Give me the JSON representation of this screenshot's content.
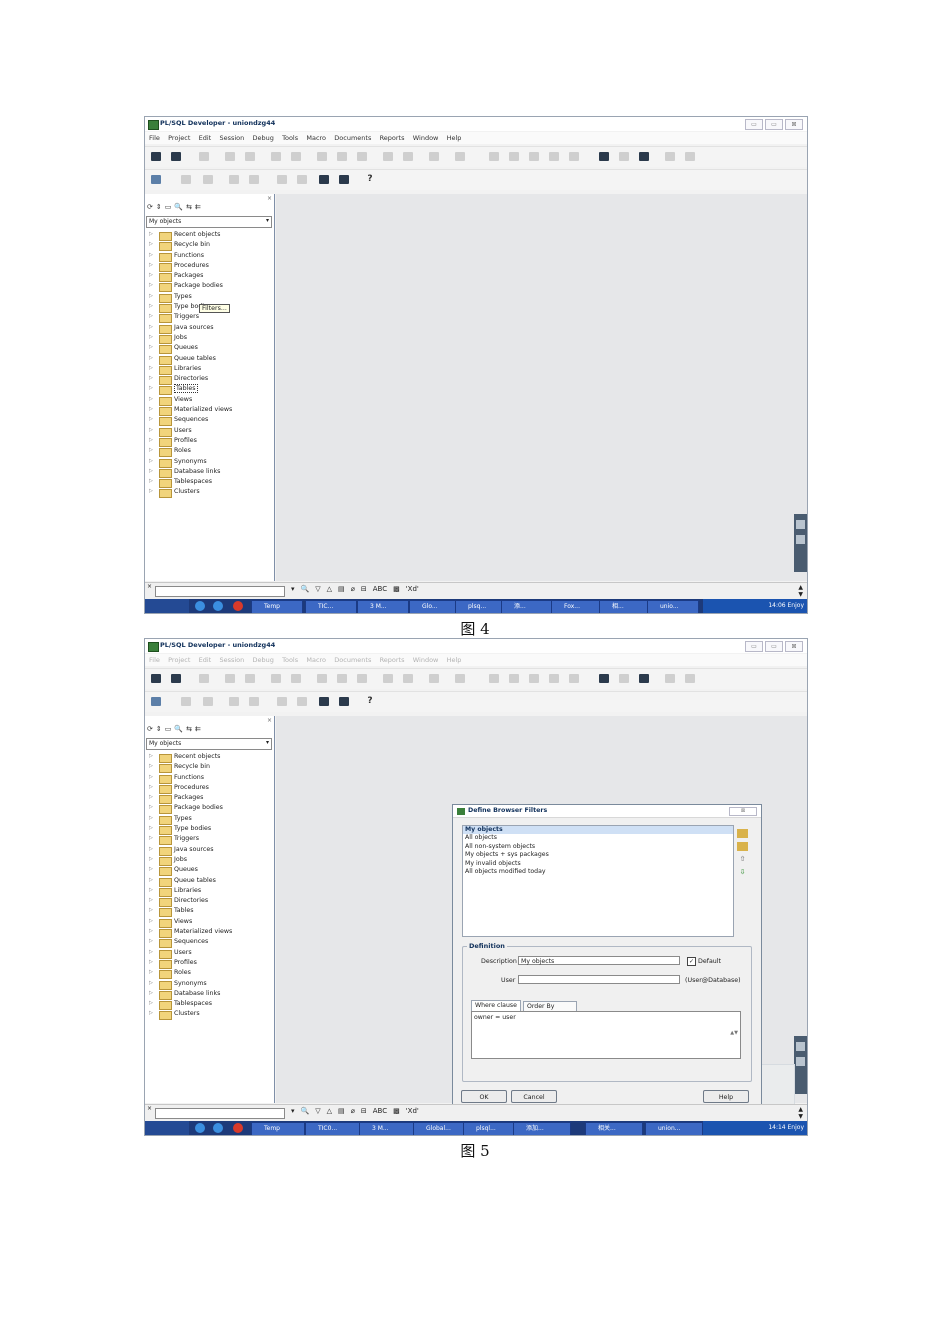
{
  "figure4": {
    "app_title": "PL/SQL Developer - uniondzg44",
    "window_buttons": [
      "▭",
      "▭",
      "⊠"
    ],
    "menu": [
      "File",
      "Project",
      "Edit",
      "Session",
      "Debug",
      "Tools",
      "Macro",
      "Documents",
      "Reports",
      "Window",
      "Help"
    ],
    "nav_icons": [
      "⟳",
      "⇕",
      "▭",
      "🔍",
      "⇆",
      "⇇"
    ],
    "selector": "My objects",
    "tree": [
      "Recent objects",
      "Recycle bin",
      "Functions",
      "Procedures",
      "Packages",
      "Package bodies",
      "Types",
      "Type bodies",
      "Triggers",
      "Java sources",
      "Jobs",
      "Queues",
      "Queue tables",
      "Libraries",
      "Directories",
      "Tables",
      "Views",
      "Materialized views",
      "Sequences",
      "Users",
      "Profiles",
      "Roles",
      "Synonyms",
      "Database links",
      "Tablespaces",
      "Clusters"
    ],
    "tooltip": "Filters...",
    "find_tools": [
      "▾",
      "🔍",
      "▽",
      "△",
      "▤",
      "⌀",
      "⊟",
      "ABC",
      "▩",
      "'Xd'"
    ],
    "taskbar": [
      "Temp",
      "TIC...",
      "3 M...",
      "Glo...",
      "plsq...",
      "添...",
      "Fox...",
      "相...",
      "unio..."
    ],
    "clock": "14:06 Enjoy",
    "caption": "图 4"
  },
  "figure5": {
    "app_title": "PL/SQL Developer - uniondzg44",
    "window_buttons": [
      "▭",
      "▭",
      "⊠"
    ],
    "menu": [
      "File",
      "Project",
      "Edit",
      "Session",
      "Debug",
      "Tools",
      "Macro",
      "Documents",
      "Reports",
      "Window",
      "Help"
    ],
    "nav_icons": [
      "⟳",
      "⇕",
      "▭",
      "🔍",
      "⇆",
      "⇇"
    ],
    "selector": "My objects",
    "tree": [
      "Recent objects",
      "Recycle bin",
      "Functions",
      "Procedures",
      "Packages",
      "Package bodies",
      "Types",
      "Type bodies",
      "Triggers",
      "Java sources",
      "Jobs",
      "Queues",
      "Queue tables",
      "Libraries",
      "Directories",
      "Tables",
      "Views",
      "Materialized views",
      "Sequences",
      "Users",
      "Profiles",
      "Roles",
      "Synonyms",
      "Database links",
      "Tablespaces",
      "Clusters"
    ],
    "dialog": {
      "title": "Define Browser Filters",
      "close": "⊠",
      "filters": [
        "My objects",
        "All objects",
        "All non-system objects",
        "My objects + sys packages",
        "My invalid objects",
        "All objects modified today"
      ],
      "selected_filter_index": 0,
      "up_arrow": "⇧",
      "down_arrow": "⇩",
      "definition_label": "Definition",
      "description_label": "Description",
      "description_value": "My objects",
      "default_label": "Default",
      "default_checked": "✓",
      "user_label": "User",
      "user_value": "",
      "user_hint": "(User@Database)",
      "tabs": [
        "Where clause",
        "Order By clause"
      ],
      "where_clause": "owner = user",
      "ta_scroll": "▲▼",
      "ok": "OK",
      "cancel": "Cancel",
      "help": "Help"
    },
    "find_tools": [
      "▾",
      "🔍",
      "▽",
      "△",
      "▤",
      "⌀",
      "⊟",
      "ABC",
      "▩",
      "'Xd'"
    ],
    "taskbar": [
      "Temp",
      "TIC0...",
      "3 M...",
      "Global...",
      "plsql...",
      "添加...",
      "相关...",
      "union..."
    ],
    "clock": "14:14 Enjoy",
    "caption": "图 5"
  }
}
